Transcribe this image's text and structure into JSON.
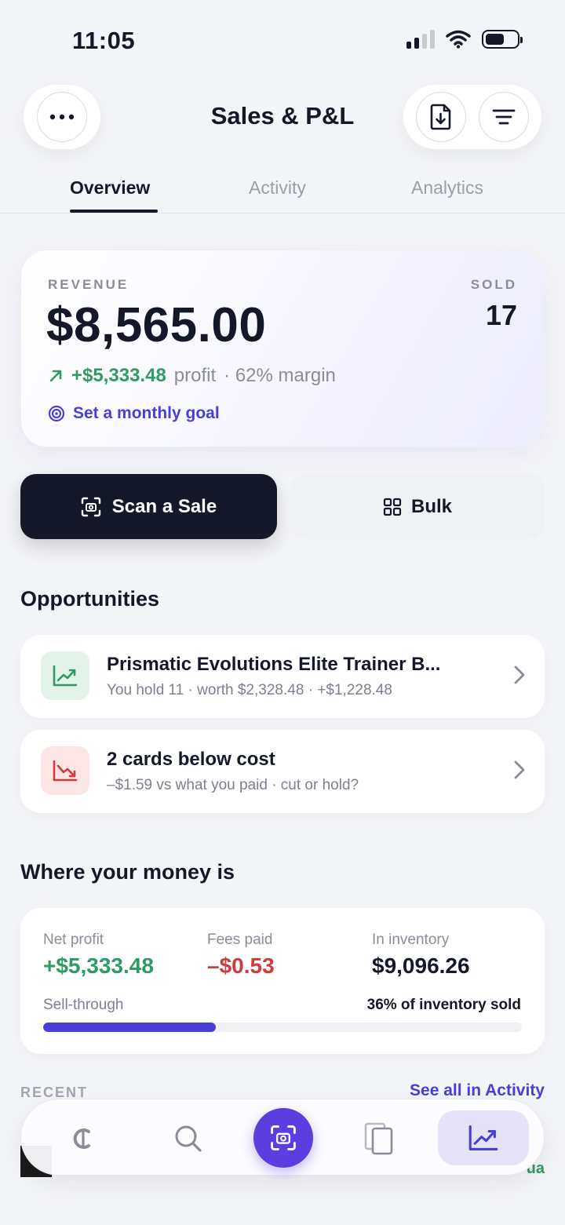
{
  "status": {
    "time": "11:05"
  },
  "header": {
    "title": "Sales & P&L"
  },
  "tabs": [
    {
      "label": "Overview",
      "active": true
    },
    {
      "label": "Activity",
      "active": false
    },
    {
      "label": "Analytics",
      "active": false
    }
  ],
  "revenue": {
    "label": "REVENUE",
    "amount": "$8,565.00",
    "sold_label": "SOLD",
    "sold_count": "17",
    "profit": "+$5,333.48",
    "profit_word": "profit",
    "margin": "· 62% margin",
    "goal_link": "Set a monthly goal"
  },
  "actions": {
    "scan_label": "Scan a Sale",
    "bulk_label": "Bulk"
  },
  "opportunities": {
    "title": "Opportunities",
    "items": [
      {
        "title": "Prismatic Evolutions Elite Trainer B...",
        "subtitle": "You hold 11 · worth $2,328.48 · +$1,228.48",
        "icon": "trend-up-icon",
        "tone": "green"
      },
      {
        "title": "2 cards below cost",
        "subtitle": "–$1.59 vs what you paid · cut or hold?",
        "icon": "trend-down-icon",
        "tone": "red"
      }
    ]
  },
  "money": {
    "title": "Where your money is",
    "net_profit_label": "Net profit",
    "net_profit_value": "+$5,333.48",
    "fees_label": "Fees paid",
    "fees_value": "–$0.53",
    "inventory_label": "In inventory",
    "inventory_value": "$9,096.26",
    "sell_through_label": "Sell-through",
    "sell_through_text": "36% of inventory sold",
    "sell_through_fraction": 0.36
  },
  "recent": {
    "label": "RECENT",
    "see_all": "See all in Activity",
    "peek_text": "ua"
  },
  "colors": {
    "accent": "#4b3ed8",
    "positive": "#2f9a63",
    "negative": "#d23b3b",
    "dark": "#141828"
  },
  "nav": [
    "collection-logo-icon",
    "search-icon",
    "camera-scan-icon",
    "cards-icon",
    "chart-icon"
  ]
}
